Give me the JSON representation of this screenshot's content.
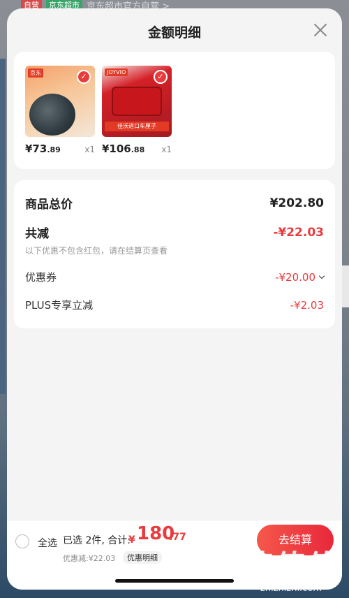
{
  "background": {
    "tag_self": "自营",
    "tag_market": "京东超市",
    "store_name": "京东超市官方自营 >"
  },
  "sheet": {
    "title": "金额明细",
    "close_icon": "close-icon"
  },
  "products": [
    {
      "brand": "京东",
      "price_int": "¥73",
      "price_dec": ".89",
      "qty": "x1",
      "icon": "shrimp-box-image"
    },
    {
      "brand": "JOYVIO",
      "price_int": "¥106",
      "price_dec": ".88",
      "qty": "x1",
      "banner": "佳沃进口车厘子",
      "icon": "cherry-box-image"
    }
  ],
  "summary": {
    "total_label": "商品总价",
    "total_value": "¥202.80",
    "reduce_label": "共减",
    "reduce_value": "-¥22.03",
    "reduce_note": "以下优惠不包含红包，请在结算页查看",
    "coupon_label": "优惠券",
    "coupon_value": "-¥20.00",
    "plus_label": "PLUS专享立减",
    "plus_value": "-¥2.03"
  },
  "bottom_bar": {
    "select_all": "全选",
    "selected_text": "已选 2件, 合计:",
    "total_symbol": "¥",
    "total_int": "180",
    "total_dec": ".77",
    "discount_text": "优惠减:¥22.03",
    "discount_detail": "优惠明细",
    "checkout": "去结算"
  },
  "watermark": {
    "big": "值值值",
    "small": "zhizhizhi.com"
  },
  "colors": {
    "accent_red": "#e93b3d",
    "sheet_bg": "#f4f4f4"
  }
}
